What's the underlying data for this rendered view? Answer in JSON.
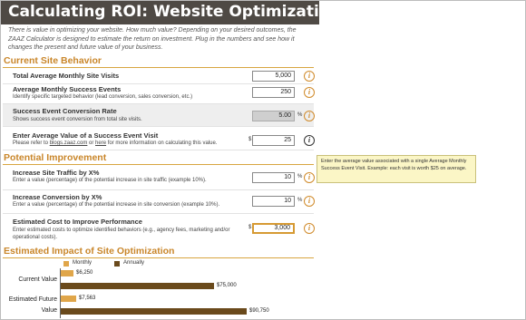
{
  "title": "Calculating ROI: Website Optimization",
  "intro": "There is value in optimizing your website. How much value? Depending on your desired outcomes, the ZAAZ Calculator is designed to estimate the return on investment. Plug in the numbers and see how it changes the present and future value of your business.",
  "sections": {
    "current": "Current Site Behavior",
    "potential": "Potential Improvement",
    "impact": "Estimated Impact of Site Optimization"
  },
  "fields": {
    "visits": {
      "label": "Total Average Monthly Site Visits",
      "value": "5,000"
    },
    "events": {
      "label": "Average Monthly Success Events",
      "sub": "Identify specific targeted behavior (lead conversion, sales conversion, etc.)",
      "value": "250"
    },
    "rate": {
      "label": "Success Event Conversion Rate",
      "sub": "Shows success event conversion from total site visits.",
      "value": "5.00",
      "suffix": "%"
    },
    "eventValue": {
      "label": "Enter Average Value of a Success Event Visit",
      "sub_pre": "Please refer to ",
      "link1": "blogs.zaaz.com",
      "sub_mid": " or ",
      "link2": "here",
      "sub_post": " for more information on calculating this value.",
      "prefix": "$",
      "value": "25"
    },
    "traffic": {
      "label": "Increase Site Traffic by X%",
      "sub": "Enter a value (percentage) of the potential increase in site traffic (example 10%).",
      "value": "10",
      "suffix": "%"
    },
    "conversion": {
      "label": "Increase Conversion by X%",
      "sub": "Enter a value (percentage) of the potential increase in site conversion (example 10%).",
      "value": "10",
      "suffix": "%"
    },
    "cost": {
      "label": "Estimated Cost to Improve Performance",
      "sub": "Enter estimated costs to optimize identified behaviors (e.g., agency fees, marketing and/or operational costs).",
      "prefix": "$",
      "value": "3,000"
    }
  },
  "info_glyph": "i",
  "tooltip": "Enter the average value associated with a single Average Monthly Success Event Visit. Example: each visit is worth $25 on average.",
  "chart_data": {
    "type": "bar",
    "orientation": "horizontal",
    "title": "Estimated Impact of Site Optimization",
    "categories": [
      "Current Value",
      "Estimated Future Value"
    ],
    "category_lines": [
      [
        "Current Value"
      ],
      [
        "Estimated Future",
        "Value"
      ]
    ],
    "series": [
      {
        "name": "Monthly",
        "color": "#e0a64a",
        "values": [
          6250,
          7563
        ],
        "labels": [
          "$6,250",
          "$7,563"
        ]
      },
      {
        "name": "Annually",
        "color": "#6a4a1c",
        "values": [
          75000,
          90750
        ],
        "labels": [
          "$75,000",
          "$90,750"
        ]
      }
    ],
    "xlim": [
      0,
      90750
    ]
  },
  "colors": {
    "title_bg": "#4f4a45",
    "section": "#c9862a",
    "accent": "#d69a33"
  }
}
